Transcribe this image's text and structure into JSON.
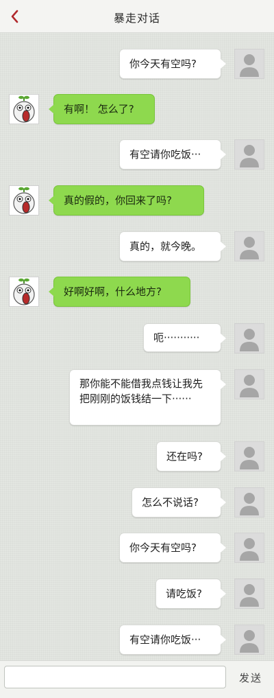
{
  "header": {
    "title": "暴走对话"
  },
  "input": {
    "value": "",
    "placeholder": ""
  },
  "send_label": "发送",
  "messages": [
    {
      "side": "right",
      "text": "你今天有空吗?"
    },
    {
      "side": "left",
      "text": "有啊！ 怎么了?"
    },
    {
      "side": "right",
      "text": "有空请你吃饭···"
    },
    {
      "side": "left",
      "text": "真的假的，你回来了吗?"
    },
    {
      "side": "right",
      "text": "真的，就今晚。"
    },
    {
      "side": "left",
      "text": "好啊好啊，什么地方?"
    },
    {
      "side": "right",
      "text": "呃···········"
    },
    {
      "side": "right",
      "text": "那你能不能借我点钱让我先把刚刚的饭钱结一下······"
    },
    {
      "side": "right",
      "text": "还在吗?"
    },
    {
      "side": "right",
      "text": "怎么不说话?"
    },
    {
      "side": "right",
      "text": "你今天有空吗?"
    },
    {
      "side": "right",
      "text": "请吃饭?"
    },
    {
      "side": "right",
      "text": "有空请你吃饭···"
    }
  ],
  "colors": {
    "accent_back": "#b0282c",
    "bubble_green": "#8ed94e",
    "bubble_white": "#ffffff"
  },
  "icons": {
    "back": "chevron-left-icon",
    "user": "default-user-avatar",
    "friend": "rage-comic-face-avatar"
  }
}
